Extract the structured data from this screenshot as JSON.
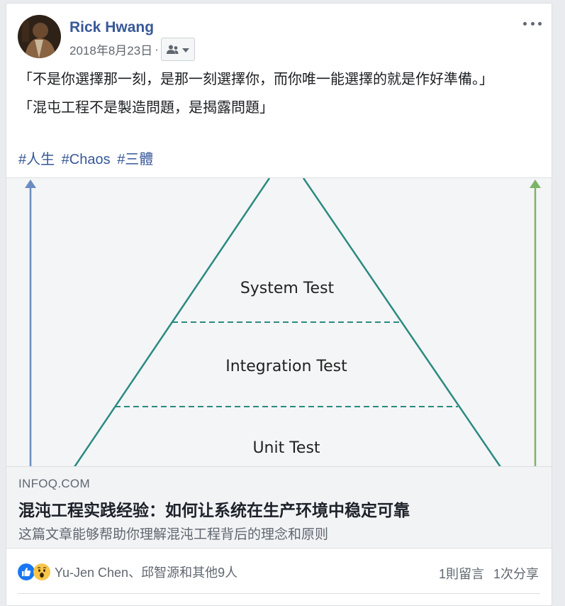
{
  "post": {
    "author": "Rick Hwang",
    "timestamp": "2018年8月23日",
    "separator": "·",
    "audience_icon": "friends-icon",
    "more_icon": "more-options-icon",
    "paragraphs": [
      "「不是你選擇那一刻，是那一刻選擇你，而你唯一能選擇的就是作好準備。」",
      "「混屯工程不是製造問題，是揭露問題」"
    ],
    "hashtags": [
      "#人生",
      "#Chaos",
      "#三體"
    ]
  },
  "link_preview": {
    "image_labels": [
      "System Test",
      "Integration Test",
      "Unit Test"
    ],
    "domain": "INFOQ.COM",
    "title": "混沌工程实践经验：如何让系统在生产环境中稳定可靠",
    "description": "这篇文章能够帮助你理解混沌工程背后的理念和原则"
  },
  "footer": {
    "reaction_icons": [
      "like-icon",
      "wow-icon"
    ],
    "reactors": "Yu-Jen Chen、邱智源和其他9人",
    "comments": "1則留言",
    "shares": "1次分享"
  },
  "colors": {
    "link": "#385898",
    "pyramid_line": "#2a8a80",
    "arrow_left": "#6b8cc0",
    "arrow_right": "#7ab568",
    "like_blue": "#1877f2"
  }
}
